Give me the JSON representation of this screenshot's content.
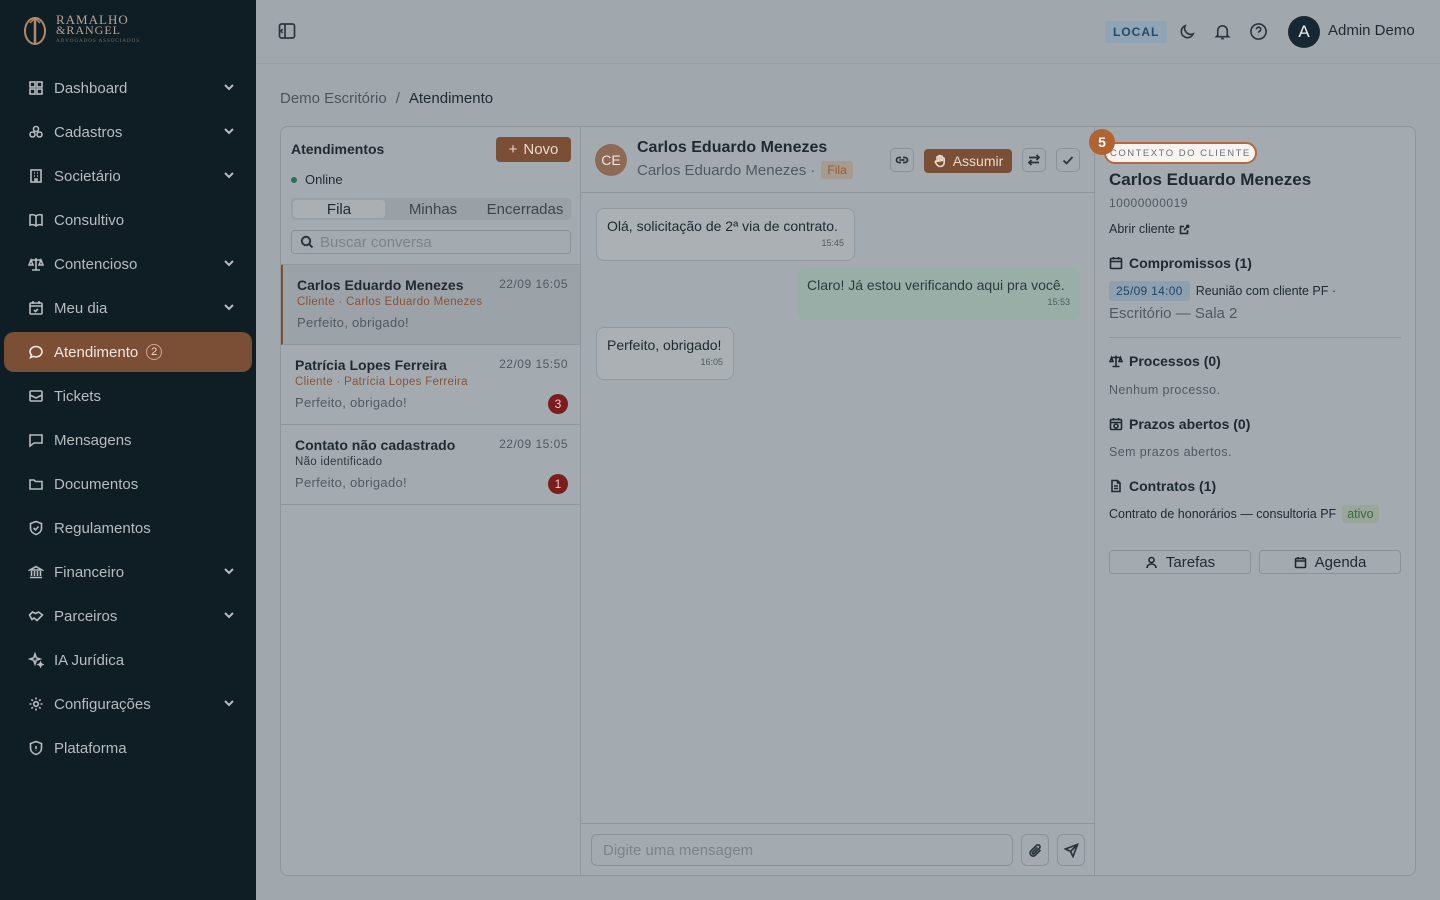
{
  "logo": {
    "line1": "RAMALHO",
    "line2": "&RANGEL",
    "line3": "ADVOGADOS ASSOCIADOS"
  },
  "sidebar": {
    "items": [
      {
        "label": "Dashboard",
        "icon": "dashboard-icon",
        "chevron": true
      },
      {
        "label": "Cadastros",
        "icon": "users-icon",
        "chevron": true
      },
      {
        "label": "Societário",
        "icon": "building-icon",
        "chevron": true
      },
      {
        "label": "Consultivo",
        "icon": "book-icon",
        "chevron": false
      },
      {
        "label": "Contencioso",
        "icon": "scale-icon",
        "chevron": true
      },
      {
        "label": "Meu dia",
        "icon": "calendar-icon",
        "chevron": true
      },
      {
        "label": "Atendimento",
        "icon": "chat-icon",
        "chevron": false,
        "active": true,
        "badge": "2"
      },
      {
        "label": "Tickets",
        "icon": "ticket-icon",
        "chevron": false
      },
      {
        "label": "Mensagens",
        "icon": "message-icon",
        "chevron": false
      },
      {
        "label": "Documentos",
        "icon": "folder-icon",
        "chevron": false
      },
      {
        "label": "Regulamentos",
        "icon": "shield-check-icon",
        "chevron": false
      },
      {
        "label": "Financeiro",
        "icon": "bank-icon",
        "chevron": true
      },
      {
        "label": "Parceiros",
        "icon": "handshake-icon",
        "chevron": true
      },
      {
        "label": "IA Jurídica",
        "icon": "sparkles-icon",
        "chevron": false
      },
      {
        "label": "Configurações",
        "icon": "gear-icon",
        "chevron": true
      },
      {
        "label": "Plataforma",
        "icon": "shield-icon",
        "chevron": false
      }
    ]
  },
  "topbar": {
    "env_badge": "LOCAL",
    "user_initial": "A",
    "user_name": "Admin Demo"
  },
  "breadcrumb": {
    "parent": "Demo Escritório",
    "separator": "/",
    "current": "Atendimento"
  },
  "list": {
    "title": "Atendimentos",
    "new_label": "Novo",
    "status": "Online",
    "tabs": [
      "Fila",
      "Minhas",
      "Encerradas"
    ],
    "active_tab": "Fila",
    "search_placeholder": "Buscar conversa",
    "conversations": [
      {
        "name": "Carlos Eduardo Menezes",
        "time": "22/09 16:05",
        "sub": "Cliente · Carlos Eduardo Menezes",
        "last": "Perfeito, obrigado!",
        "unread": null,
        "active": true
      },
      {
        "name": "Patrícia Lopes Ferreira",
        "time": "22/09 15:50",
        "sub": "Cliente · Patrícia Lopes Ferreira",
        "last": "Perfeito, obrigado!",
        "unread": "3",
        "active": false
      },
      {
        "name": "Contato não cadastrado",
        "time": "22/09 15:05",
        "sub": "Não identificado",
        "last": "Perfeito, obrigado!",
        "unread": "1",
        "active": false
      }
    ]
  },
  "chat": {
    "avatar_initials": "CE",
    "name": "Carlos Eduardo Menezes",
    "subtitle": "Carlos Eduardo Menezes ·",
    "queue_tag": "Fila",
    "assume_label": "Assumir",
    "messages": [
      {
        "direction": "in",
        "text": "Olá, solicitação de 2ª via de contrato.",
        "time": "15:45"
      },
      {
        "direction": "out",
        "text": "Claro! Já estou verificando aqui pra você.",
        "time": "15:53"
      },
      {
        "direction": "in",
        "text": "Perfeito, obrigado!",
        "time": "16:05"
      }
    ],
    "input_placeholder": "Digite uma mensagem"
  },
  "context": {
    "step_number": "5",
    "label": "CONTEXTO DO CLIENTE",
    "client_name": "Carlos Eduardo Menezes",
    "client_doc": "10000000019",
    "open_client": "Abrir cliente",
    "compromissos_title": "Compromissos (1)",
    "compromisso_date": "25/09 14:00",
    "compromisso_desc": "Reunião com cliente PF ·",
    "compromisso_loc": "Escritório — Sala 2",
    "processos_title": "Processos (0)",
    "processos_empty": "Nenhum processo.",
    "prazos_title": "Prazos abertos (0)",
    "prazos_empty": "Sem prazos abertos.",
    "contratos_title": "Contratos (1)",
    "contrato_desc": "Contrato de honorários — consultoria PF",
    "contrato_status": "ativo",
    "btn_tarefas": "Tarefas",
    "btn_agenda": "Agenda"
  },
  "colors": {
    "sidebar_bg": "#0f1d25",
    "accent": "#7a4f35",
    "badge_red": "#7b1d1d",
    "step_badge": "#b26332"
  }
}
